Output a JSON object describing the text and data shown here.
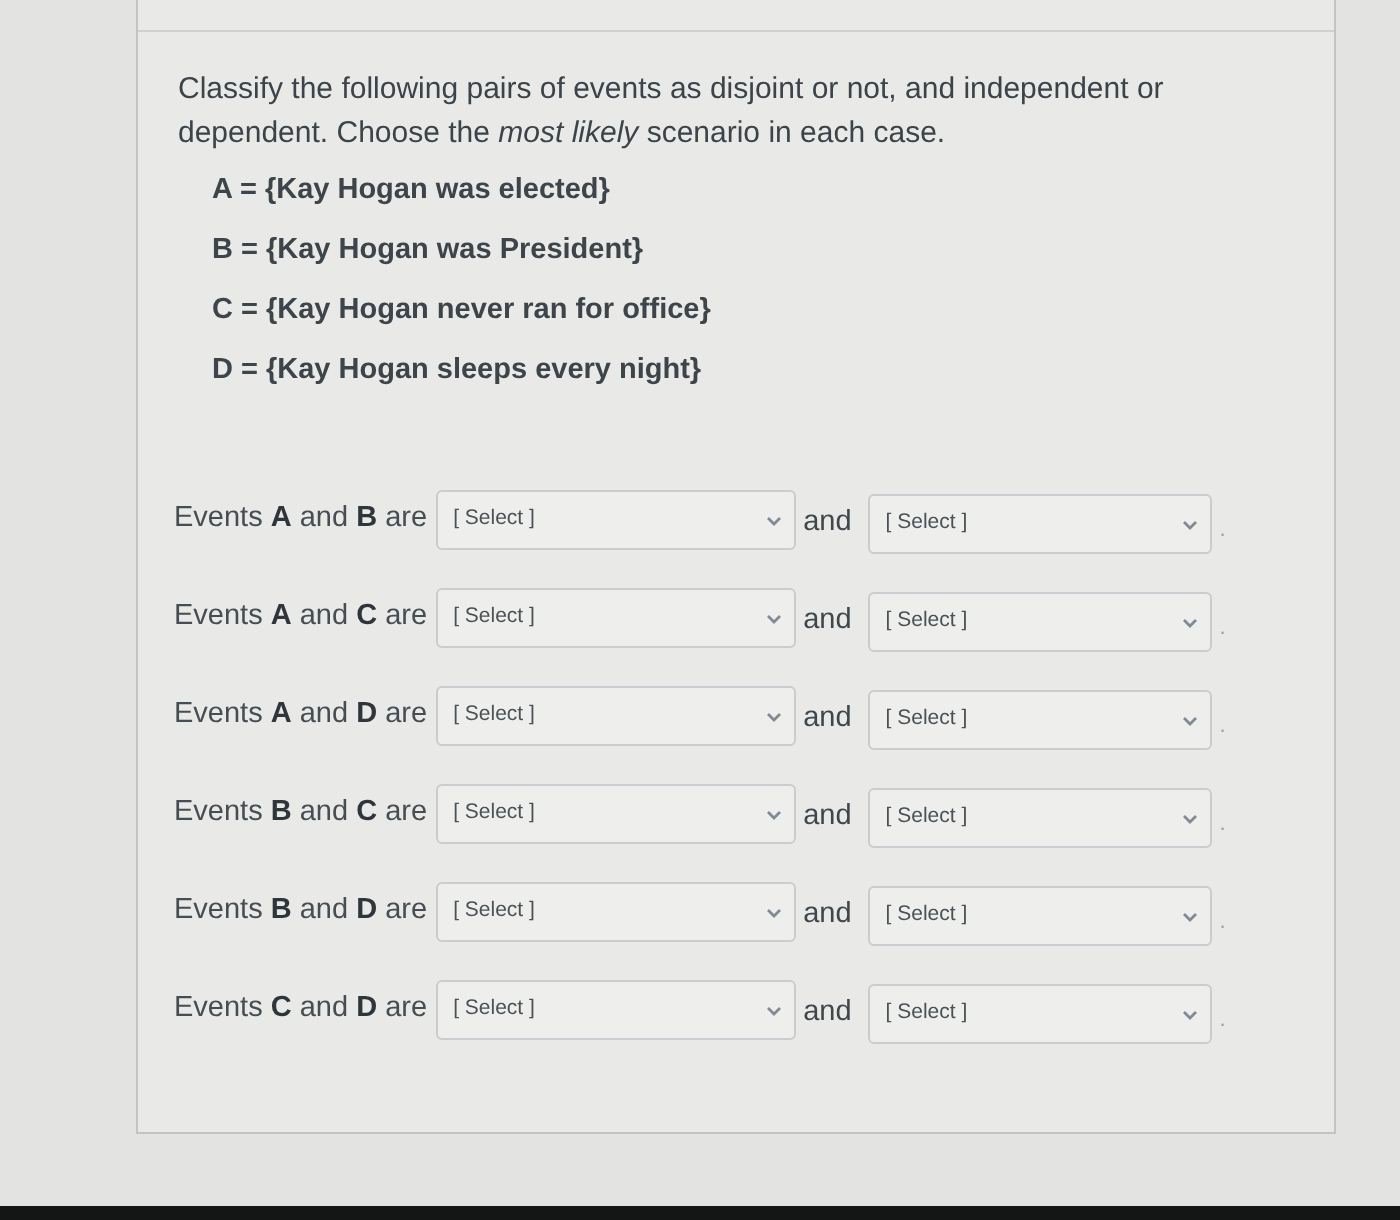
{
  "question": {
    "prompt": "Classify the following pairs of events as disjoint or not, and independent or dependent.  Choose the *most likely* scenario in each case.",
    "definitions": [
      "A = {Kay Hogan was elected}",
      "B = {Kay Hogan was President}",
      "C = {Kay Hogan never ran for office}",
      "D = {Kay Hogan sleeps every night}"
    ]
  },
  "rows": [
    {
      "label": "Events **A** and **B** are",
      "dropdown_1": {
        "value": "[ Select ]"
      },
      "connector": "and",
      "dropdown_2": {
        "value": "[ Select ]"
      },
      "end": "."
    },
    {
      "label": "Events **A** and **C** are",
      "dropdown_1": {
        "value": "[ Select ]"
      },
      "connector": "and",
      "dropdown_2": {
        "value": "[ Select ]"
      },
      "end": "."
    },
    {
      "label": "Events **A** and **D** are",
      "dropdown_1": {
        "value": "[ Select ]"
      },
      "connector": "and",
      "dropdown_2": {
        "value": "[ Select ]"
      },
      "end": "."
    },
    {
      "label": "Events **B** and **C** are",
      "dropdown_1": {
        "value": "[ Select ]"
      },
      "connector": "and",
      "dropdown_2": {
        "value": "[ Select ]"
      },
      "end": "."
    },
    {
      "label": "Events **B** and **D** are",
      "dropdown_1": {
        "value": "[ Select ]"
      },
      "connector": "and",
      "dropdown_2": {
        "value": "[ Select ]"
      },
      "end": "."
    },
    {
      "label": "Events **C** and **D** are",
      "dropdown_1": {
        "value": "[ Select ]"
      },
      "connector": "and",
      "dropdown_2": {
        "value": "[ Select ]"
      },
      "end": "."
    }
  ]
}
